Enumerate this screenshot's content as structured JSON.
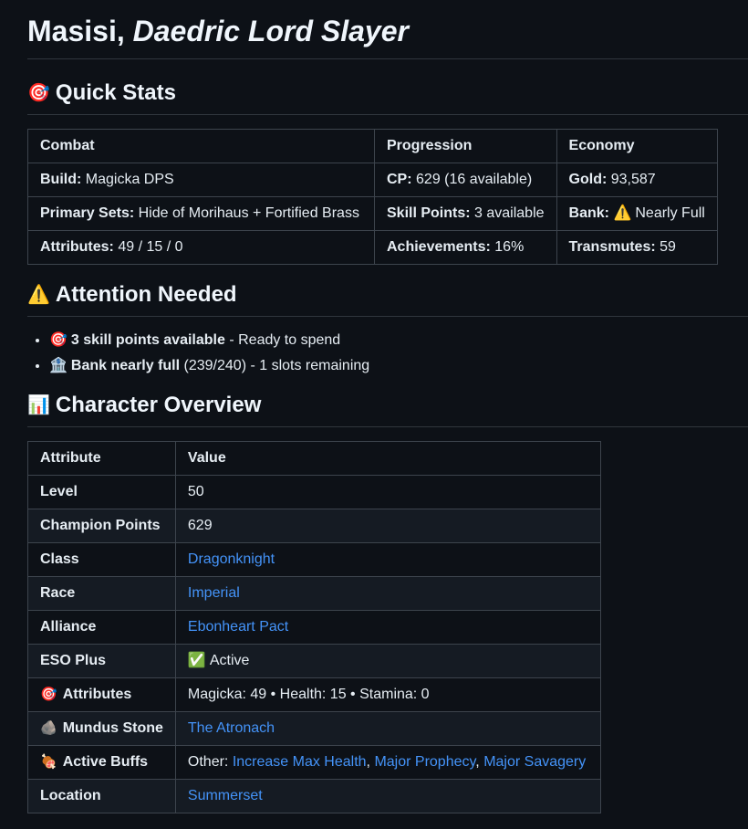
{
  "title": {
    "name": "Masisi,",
    "epithet": "Daedric Lord Slayer"
  },
  "quick_stats": {
    "heading": "Quick Stats",
    "icon": "target-icon",
    "headers": [
      "Combat",
      "Progression",
      "Economy"
    ],
    "rows": [
      [
        {
          "label": "Build:",
          "value": "Magicka DPS"
        },
        {
          "label": "CP:",
          "value": "629 (16 available)"
        },
        {
          "label": "Gold:",
          "value": "93,587"
        }
      ],
      [
        {
          "label": "Primary Sets:",
          "value": "Hide of Morihaus + Fortified Brass"
        },
        {
          "label": "Skill Points:",
          "value": "3 available"
        },
        {
          "label": "Bank:",
          "value": "Nearly Full",
          "icon": "⚠️"
        }
      ],
      [
        {
          "label": "Attributes:",
          "value": "49 / 15 / 0"
        },
        {
          "label": "Achievements:",
          "value": "16%"
        },
        {
          "label": "Transmutes:",
          "value": "59"
        }
      ]
    ]
  },
  "attention": {
    "heading": "Attention Needed",
    "icon": "warning-icon",
    "items": [
      {
        "icon": "🎯",
        "bold": "3 skill points available",
        "rest": " - Ready to spend"
      },
      {
        "icon": "🏦",
        "bold": "Bank nearly full",
        "rest": " (239/240) - 1 slots remaining"
      }
    ]
  },
  "overview": {
    "heading": "Character Overview",
    "icon": "bar-chart-icon",
    "headers": [
      "Attribute",
      "Value"
    ],
    "rows": [
      {
        "key": "Level",
        "value": "50"
      },
      {
        "key": "Champion Points",
        "value": "629"
      },
      {
        "key": "Class",
        "link": "Dragonknight"
      },
      {
        "key": "Race",
        "link": "Imperial"
      },
      {
        "key": "Alliance",
        "link": "Ebonheart Pact"
      },
      {
        "key": "ESO Plus",
        "icon": "✅",
        "value": "Active"
      },
      {
        "key": "Attributes",
        "key_icon": "🎯",
        "value": "Magicka: 49 • Health: 15 • Stamina: 0"
      },
      {
        "key": "Mundus Stone",
        "key_icon": "🪨",
        "link": "The Atronach"
      },
      {
        "key": "Active Buffs",
        "key_icon": "🍖",
        "prefix": "Other: ",
        "links": [
          "Increase Max Health",
          "Major Prophecy",
          "Major Savagery"
        ]
      },
      {
        "key": "Location",
        "link": "Summerset"
      }
    ]
  }
}
